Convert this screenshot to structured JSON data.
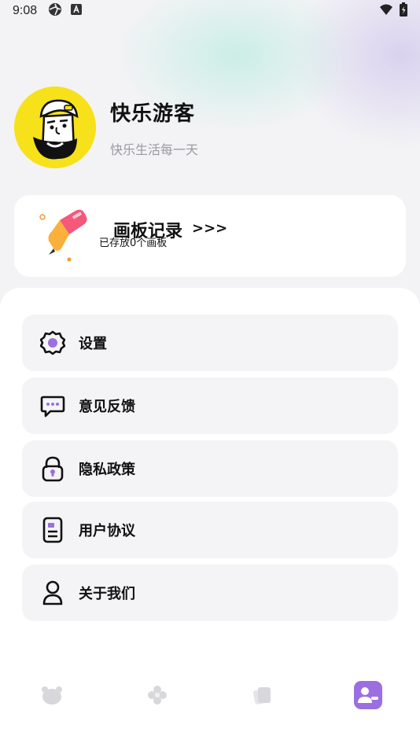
{
  "status_bar": {
    "time": "9:08",
    "icons": [
      "aperture-icon",
      "a-letter-icon",
      "wifi-icon",
      "battery-icon"
    ]
  },
  "profile": {
    "name": "快乐游客",
    "motto": "快乐生活每一天"
  },
  "board": {
    "title": "画板记录",
    "arrow": ">>>",
    "subtitle": "已存放0个画板"
  },
  "menu": {
    "items": [
      {
        "label": "设置",
        "icon": "gear-icon"
      },
      {
        "label": "意见反馈",
        "icon": "chat-icon"
      },
      {
        "label": "隐私政策",
        "icon": "lock-icon"
      },
      {
        "label": "用户协议",
        "icon": "document-icon"
      },
      {
        "label": "关于我们",
        "icon": "person-icon"
      }
    ]
  },
  "tabs": [
    {
      "icon": "bear-icon",
      "active": false
    },
    {
      "icon": "flower-icon",
      "active": false
    },
    {
      "icon": "cards-icon",
      "active": false
    },
    {
      "icon": "profile-icon",
      "active": true
    }
  ],
  "colors": {
    "accent": "#9b6fe0",
    "avatar_bg": "#f7e11a",
    "inactive_tab": "#d8d8dc"
  }
}
